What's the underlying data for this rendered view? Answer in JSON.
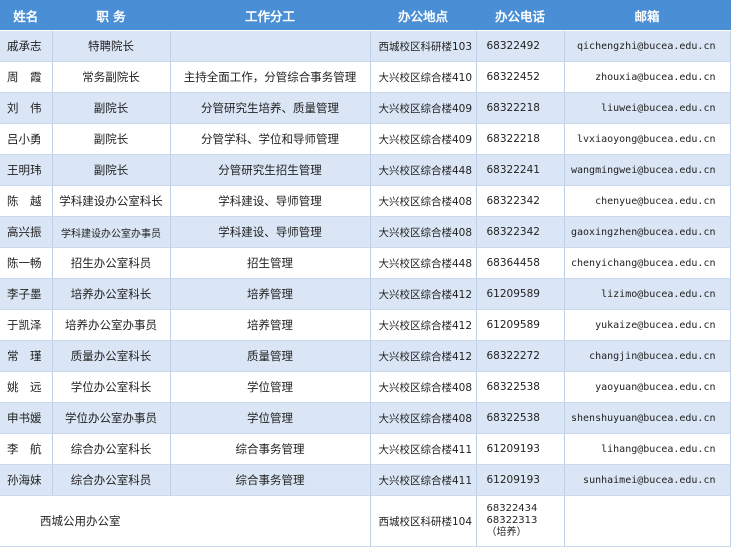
{
  "headers": [
    "姓名",
    "职 务",
    "工作分工",
    "办公地点",
    "办公电话",
    "邮箱"
  ],
  "rows": [
    {
      "name": "戚承志",
      "title": "特聘院长",
      "duty": "",
      "location": "西城校区科研楼103",
      "phone": "68322492",
      "email": "qichengzhi@bucea.edu.cn"
    },
    {
      "name": "周　霞",
      "title": "常务副院长",
      "duty": "主持全面工作，分管综合事务管理",
      "location": "大兴校区综合楼410",
      "phone": "68322452",
      "email": "zhouxia@bucea.edu.cn"
    },
    {
      "name": "刘　伟",
      "title": "副院长",
      "duty": "分管研究生培养、质量管理",
      "location": "大兴校区综合楼409",
      "phone": "68322218",
      "email": "liuwei@bucea.edu.cn"
    },
    {
      "name": "吕小勇",
      "title": "副院长",
      "duty": "分管学科、学位和导师管理",
      "location": "大兴校区综合楼409",
      "phone": "68322218",
      "email": "lvxiaoyong@bucea.edu.cn"
    },
    {
      "name": "王明玮",
      "title": "副院长",
      "duty": "分管研究生招生管理",
      "location": "大兴校区综合楼448",
      "phone": "68322241",
      "email": "wangmingwei@bucea.edu.cn"
    },
    {
      "name": "陈　越",
      "title": "学科建设办公室科长",
      "duty": "学科建设、导师管理",
      "location": "大兴校区综合楼408",
      "phone": "68322342",
      "email": "chenyue@bucea.edu.cn"
    },
    {
      "name": "高兴振",
      "title": "学科建设办公室办事员",
      "duty": "学科建设、导师管理",
      "location": "大兴校区综合楼408",
      "phone": "68322342",
      "email": "gaoxingzhen@bucea.edu.cn"
    },
    {
      "name": "陈一畅",
      "title": "招生办公室科员",
      "duty": "招生管理",
      "location": "大兴校区综合楼448",
      "phone": "68364458",
      "email": "chenyichang@bucea.edu.cn"
    },
    {
      "name": "李子墨",
      "title": "培养办公室科长",
      "duty": "培养管理",
      "location": "大兴校区综合楼412",
      "phone": "61209589",
      "email": "lizimo@bucea.edu.cn"
    },
    {
      "name": "于凯泽",
      "title": "培养办公室办事员",
      "duty": "培养管理",
      "location": "大兴校区综合楼412",
      "phone": "61209589",
      "email": "yukaize@bucea.edu.cn"
    },
    {
      "name": "常　瑾",
      "title": "质量办公室科长",
      "duty": "质量管理",
      "location": "大兴校区综合楼412",
      "phone": "68322272",
      "email": "changjin@bucea.edu.cn"
    },
    {
      "name": "姚　远",
      "title": "学位办公室科长",
      "duty": "学位管理",
      "location": "大兴校区综合楼408",
      "phone": "68322538",
      "email": "yaoyuan@bucea.edu.cn"
    },
    {
      "name": "申书媛",
      "title": "学位办公室办事员",
      "duty": "学位管理",
      "location": "大兴校区综合楼408",
      "phone": "68322538",
      "email": "shenshuyuan@bucea.edu.cn"
    },
    {
      "name": "李　航",
      "title": "综合办公室科长",
      "duty": "综合事务管理",
      "location": "大兴校区综合楼411",
      "phone": "61209193",
      "email": "lihang@bucea.edu.cn"
    },
    {
      "name": "孙海妹",
      "title": "综合办公室科员",
      "duty": "综合事务管理",
      "location": "大兴校区综合楼411",
      "phone": "61209193",
      "email": "sunhaimei@bucea.edu.cn"
    }
  ],
  "last_row": {
    "office": "西城公用办公室",
    "location": "西城校区科研楼104",
    "phones": [
      "68322434",
      "68322313",
      "（培养）"
    ]
  }
}
